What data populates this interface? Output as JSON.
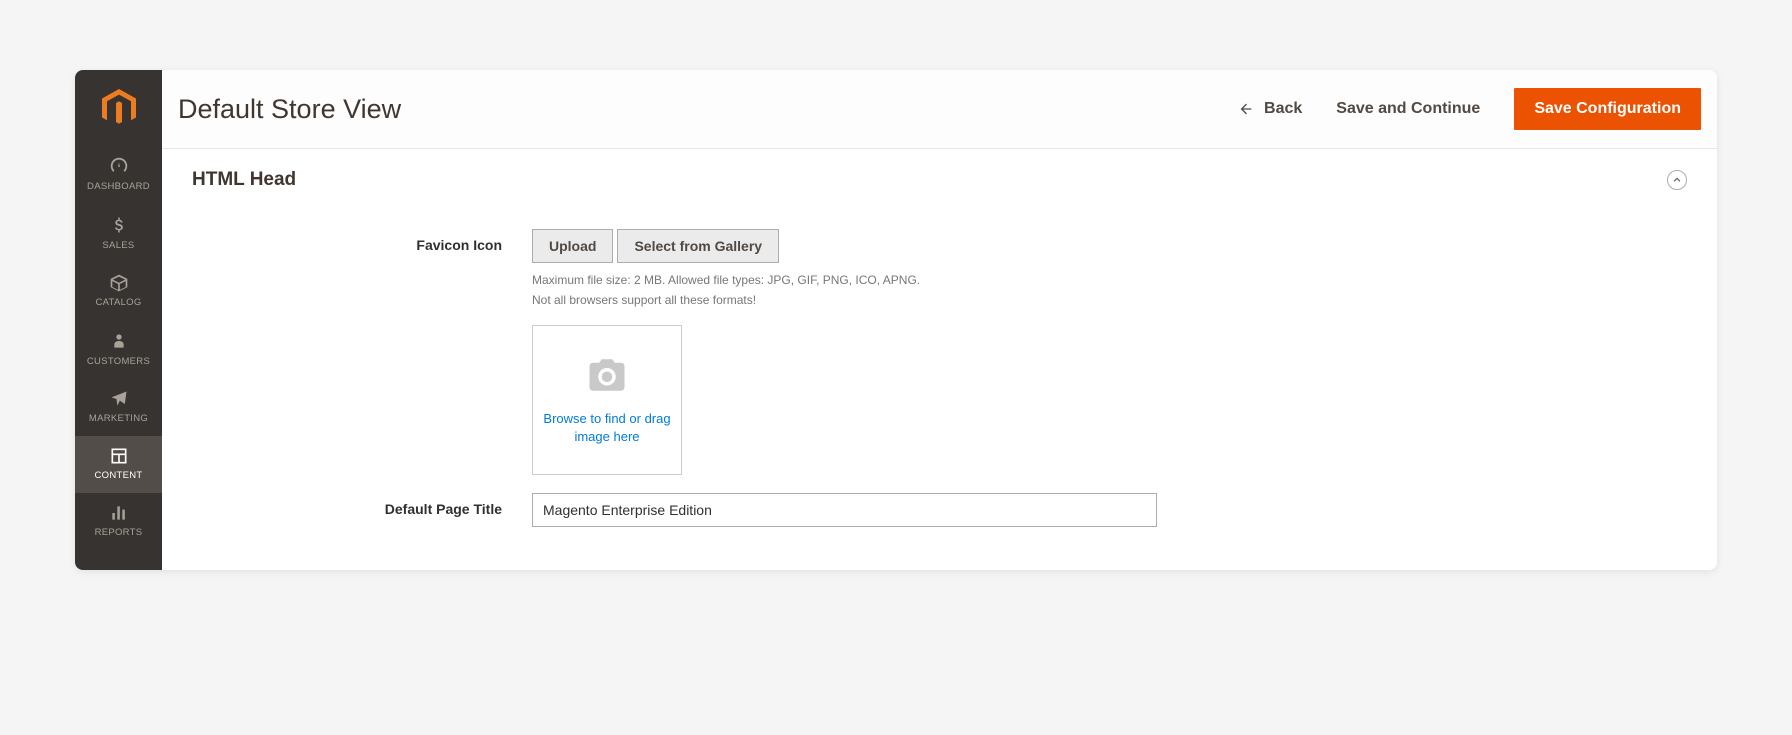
{
  "header": {
    "title": "Default Store View",
    "back_label": "Back",
    "save_continue_label": "Save and Continue",
    "save_config_label": "Save Configuration"
  },
  "sidebar": {
    "items": [
      {
        "id": "dashboard",
        "label": "DASHBOARD"
      },
      {
        "id": "sales",
        "label": "SALES"
      },
      {
        "id": "catalog",
        "label": "CATALOG"
      },
      {
        "id": "customers",
        "label": "CUSTOMERS"
      },
      {
        "id": "marketing",
        "label": "MARKETING"
      },
      {
        "id": "content",
        "label": "CONTENT"
      },
      {
        "id": "reports",
        "label": "REPORTS"
      }
    ]
  },
  "section": {
    "title": "HTML Head"
  },
  "favicon": {
    "label": "Favicon Icon",
    "upload_label": "Upload",
    "gallery_label": "Select from Gallery",
    "hint1": "Maximum file size: 2 MB. Allowed file types: JPG, GIF, PNG, ICO, APNG.",
    "hint2": "Not all browsers support all these formats!",
    "dropzone_text": "Browse to find or drag image here"
  },
  "page_title_field": {
    "label": "Default Page Title",
    "value": "Magento Enterprise Edition"
  }
}
